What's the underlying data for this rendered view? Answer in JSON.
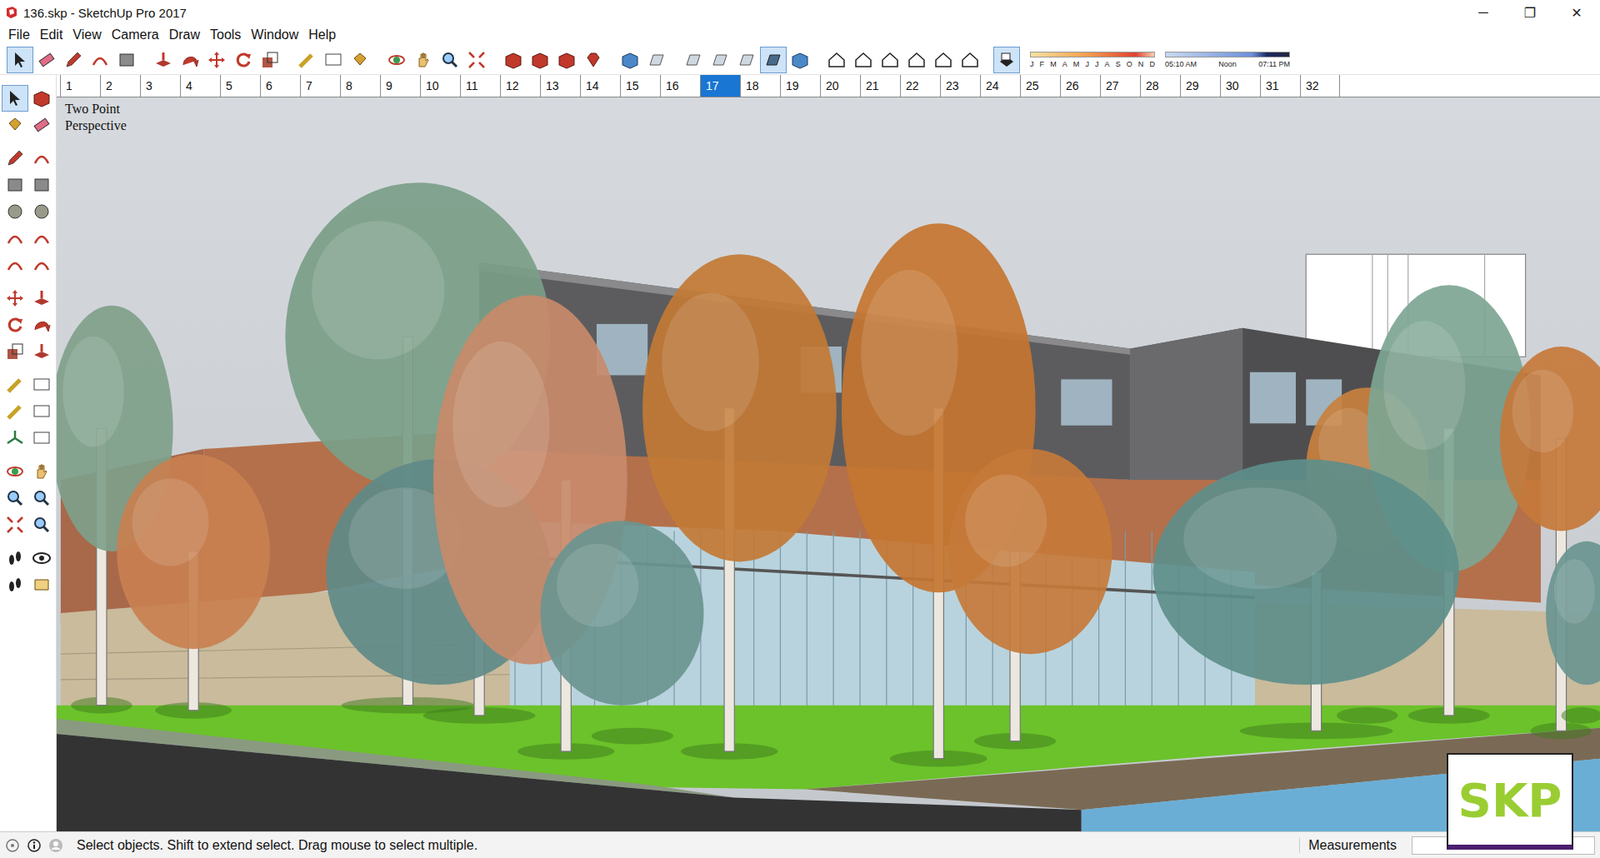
{
  "window": {
    "title": "136.skp - SketchUp Pro 2017",
    "controls": [
      "─",
      "❐",
      "✕"
    ]
  },
  "menu": [
    "File",
    "Edit",
    "View",
    "Camera",
    "Draw",
    "Tools",
    "Window",
    "Help"
  ],
  "main_toolbar": [
    {
      "buttons": [
        {
          "pressed": true
        },
        {
          "pressed": false
        },
        {
          "pressed": false
        },
        {
          "pressed": false
        },
        {
          "pressed": false
        }
      ]
    },
    {
      "buttons": [
        {
          "pressed": false
        },
        {
          "pressed": false
        },
        {
          "pressed": false
        },
        {
          "pressed": false
        },
        {
          "pressed": false
        }
      ]
    },
    {
      "buttons": [
        {
          "pressed": false
        },
        {
          "pressed": false
        },
        {
          "pressed": false
        }
      ]
    },
    {
      "buttons": [
        {
          "pressed": false
        },
        {
          "pressed": false
        },
        {
          "pressed": false
        },
        {
          "pressed": false
        }
      ]
    },
    {
      "buttons": [
        {
          "pressed": false
        },
        {
          "pressed": false
        },
        {
          "pressed": false
        },
        {
          "pressed": false
        }
      ]
    },
    {
      "buttons": [
        {
          "pressed": false
        },
        {
          "pressed": false
        }
      ]
    },
    {
      "buttons": [
        {
          "pressed": false
        },
        {
          "pressed": false
        },
        {
          "pressed": false
        },
        {
          "pressed": true
        },
        {
          "pressed": false
        }
      ]
    },
    {
      "buttons": [
        {
          "pressed": false
        },
        {
          "pressed": false
        },
        {
          "pressed": false
        },
        {
          "pressed": false
        },
        {
          "pressed": false
        },
        {
          "pressed": false
        }
      ]
    },
    {
      "buttons": [
        {
          "pressed": true
        }
      ]
    }
  ],
  "shadow": {
    "months": [
      "J",
      "F",
      "M",
      "A",
      "M",
      "J",
      "J",
      "A",
      "S",
      "O",
      "N",
      "D"
    ],
    "times": [
      "05:10 AM",
      "Noon",
      "07:11 PM"
    ]
  },
  "left_toolbar": [
    {
      "buttons": [
        {
          "pressed": true
        },
        {
          "pressed": false
        },
        {
          "pressed": false
        },
        {
          "pressed": false
        }
      ]
    },
    {
      "buttons": [
        {
          "pressed": false
        },
        {
          "pressed": false
        },
        {
          "pressed": false
        },
        {
          "pressed": false
        },
        {
          "pressed": false
        },
        {
          "pressed": false
        },
        {
          "pressed": false
        },
        {
          "pressed": false
        },
        {
          "pressed": false
        },
        {
          "pressed": false
        }
      ]
    },
    {
      "buttons": [
        {
          "pressed": false
        },
        {
          "pressed": false
        },
        {
          "pressed": false
        },
        {
          "pressed": false
        },
        {
          "pressed": false
        },
        {
          "pressed": false
        }
      ]
    },
    {
      "buttons": [
        {
          "pressed": false
        },
        {
          "pressed": false
        },
        {
          "pressed": false
        },
        {
          "pressed": false
        },
        {
          "pressed": false
        },
        {
          "pressed": false
        }
      ]
    },
    {
      "buttons": [
        {
          "pressed": false
        },
        {
          "pressed": false
        },
        {
          "pressed": false
        },
        {
          "pressed": false
        },
        {
          "pressed": false
        },
        {
          "pressed": false
        }
      ]
    },
    {
      "buttons": [
        {
          "pressed": false
        },
        {
          "pressed": false
        },
        {
          "pressed": false
        },
        {
          "pressed": false
        }
      ]
    }
  ],
  "scenes": [
    {
      "label": "1",
      "selected": false
    },
    {
      "label": "2",
      "selected": false
    },
    {
      "label": "3",
      "selected": false
    },
    {
      "label": "4",
      "selected": false
    },
    {
      "label": "5",
      "selected": false
    },
    {
      "label": "6",
      "selected": false
    },
    {
      "label": "7",
      "selected": false
    },
    {
      "label": "8",
      "selected": false
    },
    {
      "label": "9",
      "selected": false
    },
    {
      "label": "10",
      "selected": false
    },
    {
      "label": "11",
      "selected": false
    },
    {
      "label": "12",
      "selected": false
    },
    {
      "label": "13",
      "selected": false
    },
    {
      "label": "14",
      "selected": false
    },
    {
      "label": "15",
      "selected": false
    },
    {
      "label": "16",
      "selected": false
    },
    {
      "label": "17",
      "selected": true
    },
    {
      "label": "18",
      "selected": false
    },
    {
      "label": "19",
      "selected": false
    },
    {
      "label": "20",
      "selected": false
    },
    {
      "label": "21",
      "selected": false
    },
    {
      "label": "22",
      "selected": false
    },
    {
      "label": "23",
      "selected": false
    },
    {
      "label": "24",
      "selected": false
    },
    {
      "label": "25",
      "selected": false
    },
    {
      "label": "26",
      "selected": false
    },
    {
      "label": "27",
      "selected": false
    },
    {
      "label": "28",
      "selected": false
    },
    {
      "label": "29",
      "selected": false
    },
    {
      "label": "30",
      "selected": false
    },
    {
      "label": "31",
      "selected": false
    },
    {
      "label": "32",
      "selected": false
    }
  ],
  "viewport": {
    "camera": [
      "Two Point",
      "Perspective"
    ]
  },
  "badge": "SKP",
  "status_bar": {
    "message": "Select objects. Shift to extend select. Drag mouse to select multiple.",
    "measurements_label": "Measurements"
  }
}
